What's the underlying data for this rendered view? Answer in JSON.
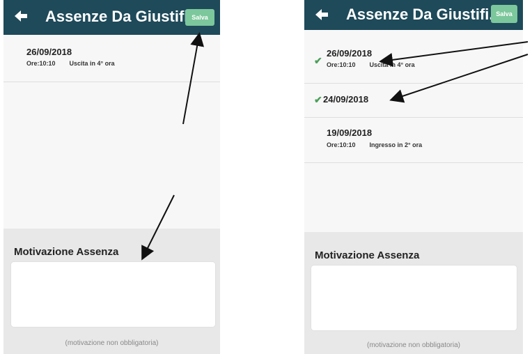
{
  "screens": [
    {
      "header": {
        "title": "Assenze Da Giustifi...",
        "save_label": "Salva"
      },
      "rows": [
        {
          "date": "26/09/2018",
          "time": "Ore:10:10",
          "reason": "Uscita in 4° ora",
          "checked": false
        }
      ],
      "motivation": {
        "label": "Motivazione Assenza",
        "value": "",
        "hint": "(motivazione non obbligatoria)"
      }
    },
    {
      "header": {
        "title": "Assenze Da Giustifi...",
        "save_label": "Salva"
      },
      "rows": [
        {
          "date": "26/09/2018",
          "time": "Ore:10:10",
          "reason": "Uscita in 4° ora",
          "checked": true
        },
        {
          "date": "24/09/2018",
          "time": "",
          "reason": "",
          "checked": true
        },
        {
          "date": "19/09/2018",
          "time": "Ore:10:10",
          "reason": "Ingresso in 2° ora",
          "checked": false
        }
      ],
      "motivation": {
        "label": "Motivazione Assenza",
        "value": "",
        "hint": "(motivazione non obbligatoria)"
      }
    }
  ],
  "colors": {
    "header_bg": "#1e4a5a",
    "save_bg": "#7cc79c",
    "check": "#4aa05a",
    "annotation_arrow": "#111111"
  },
  "icons": {
    "back": "arrow-left-icon",
    "check": "check-icon"
  }
}
